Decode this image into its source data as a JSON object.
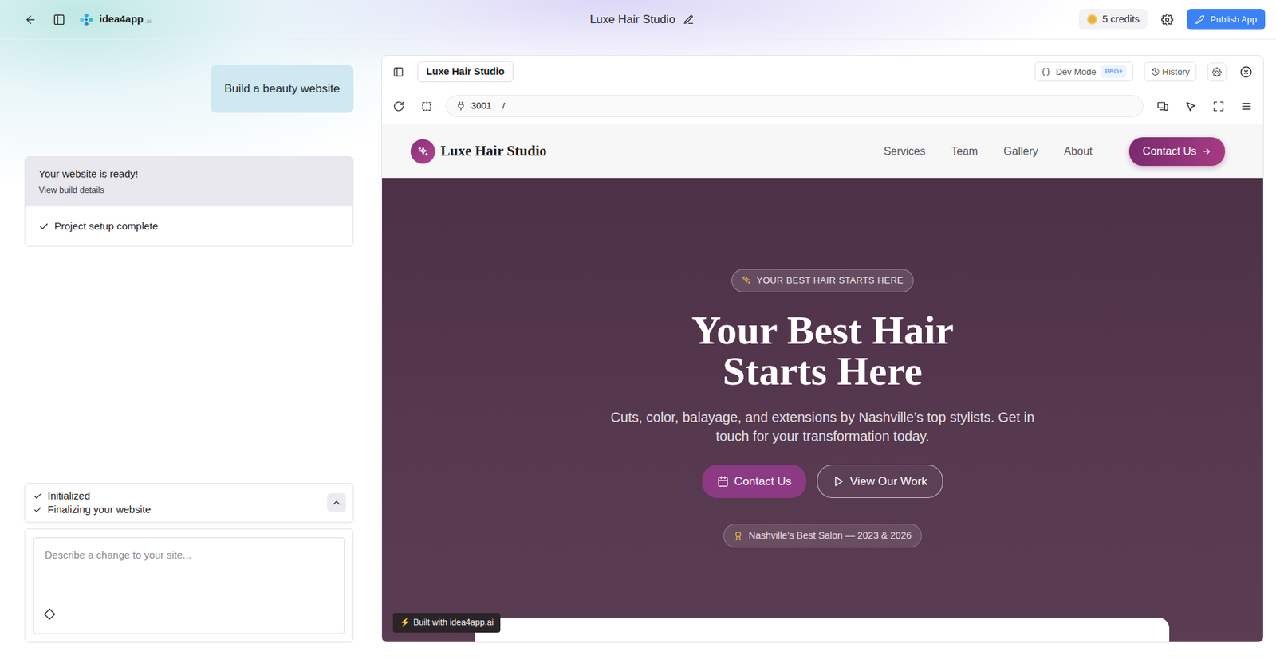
{
  "app": {
    "logo": "idea4app",
    "logo_suffix": ".ai",
    "title": "Luxe Hair Studio",
    "credits": "5 credits",
    "publish": "Publish App"
  },
  "chat": {
    "user_message": "Build a beauty website",
    "status": {
      "title": "Your website is ready!",
      "link": "View build details",
      "steps": [
        {
          "label": "Project setup complete",
          "done": true
        }
      ]
    },
    "progress": {
      "expanded": true,
      "steps": [
        {
          "label": "Initialized",
          "done": true
        },
        {
          "label": "Finalizing your website",
          "done": true
        }
      ]
    },
    "input": {
      "placeholder": "Describe a change to your site..."
    }
  },
  "preview": {
    "tab": "Luxe Hair Studio",
    "dev_mode": "Dev Mode",
    "dev_badge": "PRO+",
    "history": "History",
    "port": "3001",
    "path": "/"
  },
  "site": {
    "brand": "Luxe Hair Studio",
    "nav": [
      "Services",
      "Team",
      "Gallery",
      "About"
    ],
    "cta": "Contact Us",
    "hero": {
      "eyebrow": "YOUR BEST HAIR STARTS HERE",
      "title": "Your Best Hair Starts Here",
      "subtitle": "Cuts, color, balayage, and extensions by Nashville’s top stylists. Get in touch for your transformation today.",
      "primary": "Contact Us",
      "secondary": "View Our Work",
      "award": "Nashville’s Best Salon — 2023 & 2026"
    },
    "built_with_icon": "⚡",
    "built_with": "Built with idea4app.ai"
  }
}
